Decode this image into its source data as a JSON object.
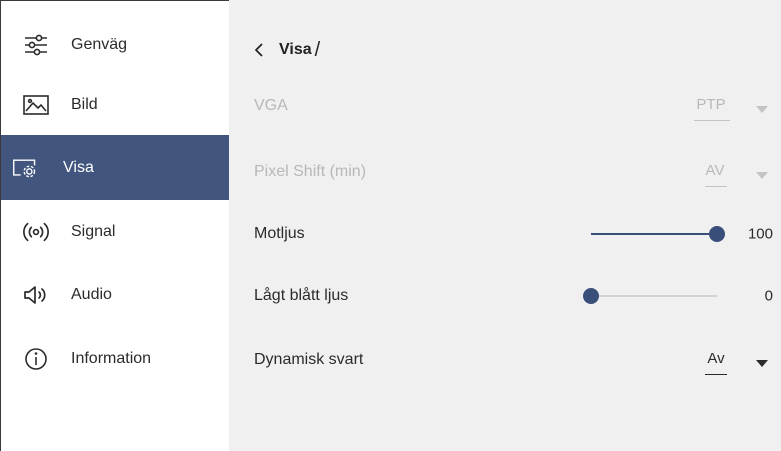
{
  "sidebar": {
    "items": [
      {
        "label": "Genväg",
        "icon": "sliders-icon",
        "active": false
      },
      {
        "label": "Bild",
        "icon": "picture-icon",
        "active": false
      },
      {
        "label": "Visa",
        "icon": "display-settings-icon",
        "active": true
      },
      {
        "label": "Signal",
        "icon": "signal-broadcast-icon",
        "active": false
      },
      {
        "label": "Audio",
        "icon": "speaker-icon",
        "active": false
      },
      {
        "label": "Information",
        "icon": "info-icon",
        "active": false
      }
    ]
  },
  "header": {
    "title": "Visa",
    "separator": "/"
  },
  "settings": {
    "vga": {
      "label": "VGA",
      "value": "PTP",
      "disabled": true
    },
    "pixel_shift": {
      "label": "Pixel Shift (min)",
      "value": "AV",
      "disabled": true
    },
    "backlight": {
      "label": "Motljus",
      "value": "100",
      "level": 100,
      "max": 100
    },
    "low_blue_light": {
      "label": "Lågt blått ljus",
      "value": "0",
      "level": 0,
      "max": 100
    },
    "dynamic_black": {
      "label": "Dynamisk svart",
      "value": "Av",
      "disabled": false
    }
  },
  "colors": {
    "accent": "#42557e",
    "slider": "#3a4e7a",
    "disabled_text": "#b8b8b8",
    "content_bg": "#f0f0f0"
  }
}
